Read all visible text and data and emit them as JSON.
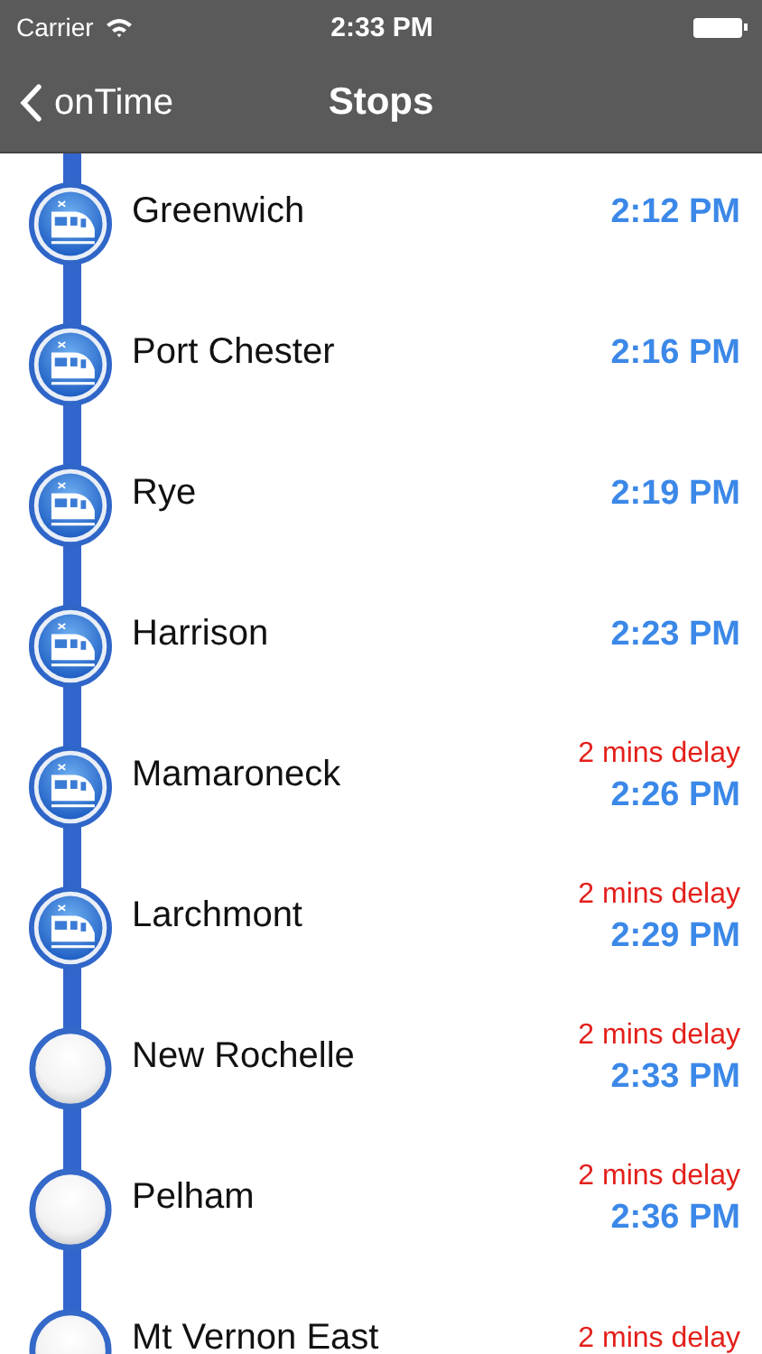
{
  "status_bar": {
    "carrier": "Carrier",
    "time": "2:33 PM"
  },
  "nav_bar": {
    "back": "onTime",
    "title": "Stops"
  },
  "stops": [
    {
      "name": "Greenwich",
      "time": "2:12 PM",
      "passed": true
    },
    {
      "name": "Port Chester",
      "time": "2:16 PM",
      "passed": true
    },
    {
      "name": "Rye",
      "time": "2:19 PM",
      "passed": true
    },
    {
      "name": "Harrison",
      "time": "2:23 PM",
      "passed": true
    },
    {
      "name": "Mamaroneck",
      "delay": "2 mins delay",
      "time": "2:26 PM",
      "passed": true
    },
    {
      "name": "Larchmont",
      "delay": "2 mins delay",
      "time": "2:29 PM",
      "passed": true
    },
    {
      "name": "New Rochelle",
      "delay": "2 mins delay",
      "time": "2:33 PM",
      "passed": false
    },
    {
      "name": "Pelham",
      "delay": "2 mins delay",
      "time": "2:36 PM",
      "passed": false
    },
    {
      "name": "Mt Vernon East",
      "delay": "2 mins delay",
      "passed": false
    }
  ]
}
